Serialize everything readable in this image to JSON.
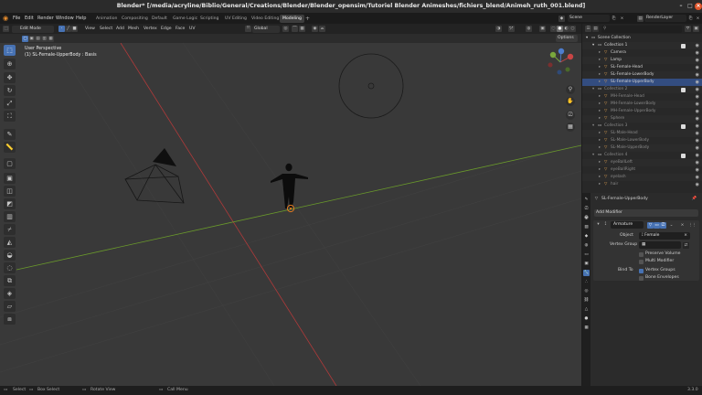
{
  "window": {
    "title": "Blender* [/media/acryline/Biblio/General/Creations/Blender/Blender_opensim/Tutoriel Blender Animeshes/fichiers_blend/Animeh_ruth_001.blend]"
  },
  "menu": [
    "File",
    "Edit",
    "Render",
    "Window",
    "Help"
  ],
  "workspaces": [
    "Animation",
    "Compositing",
    "Default",
    "Game Logic",
    "Scripting",
    "UV Editing",
    "Video Editing",
    "Modeling"
  ],
  "active_workspace": "Modeling",
  "scene": {
    "label": "Scene",
    "render_layer": "RenderLayer"
  },
  "viewport_header": {
    "mode": "Edit Mode",
    "menus": [
      "View",
      "Select",
      "Add",
      "Mesh",
      "Vertex",
      "Edge",
      "Face",
      "UV"
    ],
    "orientation": "Global",
    "options": "Options"
  },
  "viewport_info": {
    "line1": "User Perspective",
    "line2": "(1) SL-Female-UpperBody : Basis"
  },
  "outliner": {
    "header": "Scene Collection",
    "rows": [
      {
        "name": "Scene Collection",
        "indent": 0,
        "kind": "root"
      },
      {
        "name": "Collection 1",
        "indent": 1,
        "kind": "collection"
      },
      {
        "name": "Camera",
        "indent": 2,
        "kind": "object"
      },
      {
        "name": "Lamp",
        "indent": 2,
        "kind": "object"
      },
      {
        "name": "SL-Female-Head",
        "indent": 2,
        "kind": "object"
      },
      {
        "name": "SL-Female-LowerBody",
        "indent": 2,
        "kind": "object"
      },
      {
        "name": "SL-Female-UpperBody",
        "indent": 2,
        "kind": "object",
        "selected": true
      },
      {
        "name": "Collection 2",
        "indent": 1,
        "kind": "collection",
        "dim": true
      },
      {
        "name": "MH-Female-Head",
        "indent": 2,
        "kind": "object",
        "dim": true
      },
      {
        "name": "MH-Female-LowerBody",
        "indent": 2,
        "kind": "object",
        "dim": true
      },
      {
        "name": "MH-Female-UpperBody",
        "indent": 2,
        "kind": "object",
        "dim": true
      },
      {
        "name": "Sphere",
        "indent": 2,
        "kind": "object",
        "dim": true
      },
      {
        "name": "Collection 3",
        "indent": 1,
        "kind": "collection",
        "dim": true
      },
      {
        "name": "SL-Male-Head",
        "indent": 2,
        "kind": "object",
        "dim": true
      },
      {
        "name": "SL-Male-LowerBody",
        "indent": 2,
        "kind": "object",
        "dim": true
      },
      {
        "name": "SL-Male-UpperBody",
        "indent": 2,
        "kind": "object",
        "dim": true
      },
      {
        "name": "Collection 4",
        "indent": 1,
        "kind": "collection",
        "dim": true
      },
      {
        "name": "eyeBallLeft",
        "indent": 2,
        "kind": "object",
        "dim": true
      },
      {
        "name": "eyeBallRight",
        "indent": 2,
        "kind": "object",
        "dim": true
      },
      {
        "name": "eyelash",
        "indent": 2,
        "kind": "object",
        "dim": true
      },
      {
        "name": "hair",
        "indent": 2,
        "kind": "object",
        "dim": true
      }
    ]
  },
  "properties": {
    "object_name": "SL-Female-UpperBody",
    "add_modifier": "Add Modifier",
    "modifier_name": "Armature",
    "object_label": "Object",
    "object_value": "Female",
    "vertex_group_label": "Vertex Group",
    "preserve_volume": "Preserve Volume",
    "multi_modifier": "Multi Modifier",
    "bind_to_label": "Bind To",
    "vertex_groups": "Vertex Groups",
    "bone_envelopes": "Bone Envelopes"
  },
  "statusbar": {
    "select": "Select",
    "box_select": "Box Select",
    "rotate_view": "Rotate View",
    "call_menu": "Call Menu",
    "version": "3.3.0"
  },
  "colors": {
    "accent": "#4772b3",
    "x_axis": "#b03a3a",
    "y_axis": "#6a9a2b",
    "object_origin": "#e07a1f"
  }
}
